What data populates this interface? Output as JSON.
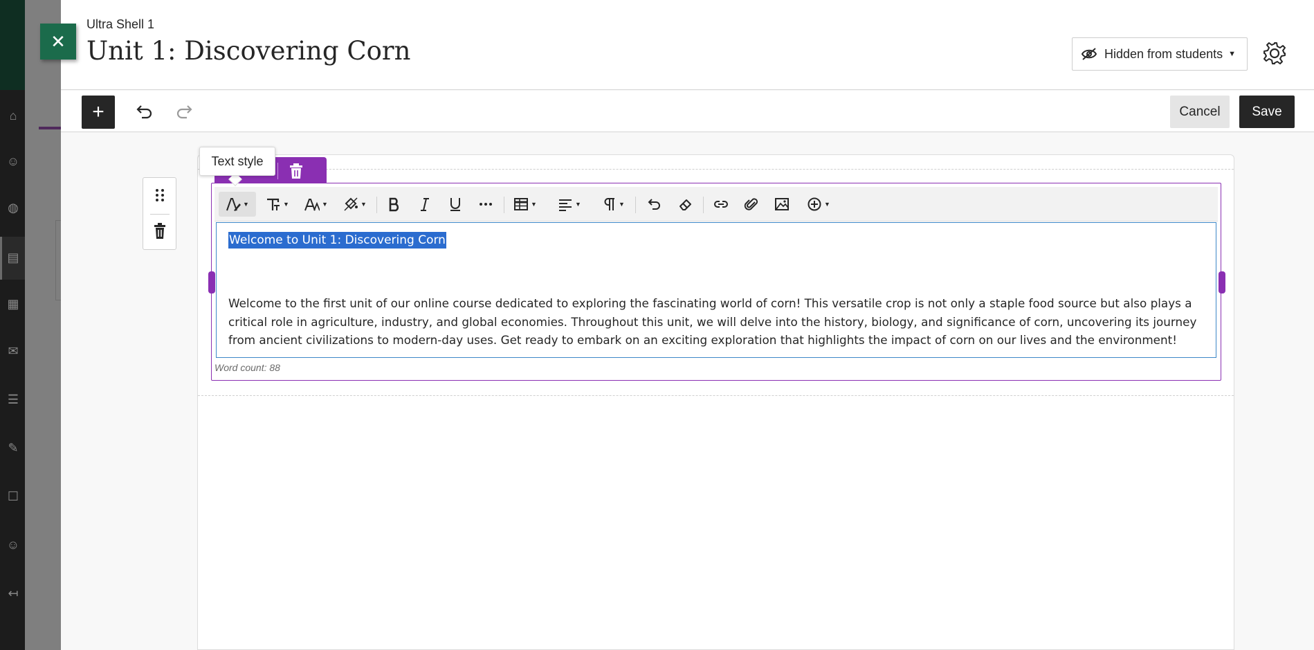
{
  "panel": {
    "course_name": "Ultra Shell 1",
    "title": "Unit 1: Discovering Corn",
    "close_glyph": "✕",
    "visibility": {
      "label": "Hidden from students",
      "icon": "eye-slash-icon"
    },
    "settings_icon": "gear-icon"
  },
  "toolbar": {
    "add_glyph": "+",
    "undo_icon": "undo-icon",
    "redo_icon": "redo-icon",
    "cancel_label": "Cancel",
    "save_label": "Save"
  },
  "tooltip": {
    "text": "Text style"
  },
  "rte": {
    "buttons": [
      {
        "name": "text-style",
        "icon": "text-style-icon",
        "dropdown": true,
        "active": true
      },
      {
        "name": "text-format",
        "icon": "text-format-icon",
        "dropdown": true
      },
      {
        "name": "font-size",
        "icon": "font-size-icon",
        "dropdown": true
      },
      {
        "name": "text-color",
        "icon": "paint-bucket-icon",
        "dropdown": true
      },
      {
        "name": "bold",
        "icon": "bold-icon"
      },
      {
        "name": "italic",
        "icon": "italic-icon"
      },
      {
        "name": "underline",
        "icon": "underline-icon"
      },
      {
        "name": "more",
        "icon": "more-dots-icon"
      },
      {
        "name": "table",
        "icon": "table-icon",
        "dropdown": true
      },
      {
        "name": "align",
        "icon": "align-left-icon",
        "dropdown": true
      },
      {
        "name": "paragraph",
        "icon": "pilcrow-icon",
        "dropdown": true
      },
      {
        "name": "undo",
        "icon": "undo-icon"
      },
      {
        "name": "clear-format",
        "icon": "eraser-icon"
      },
      {
        "name": "link",
        "icon": "link-icon"
      },
      {
        "name": "attach",
        "icon": "paperclip-icon"
      },
      {
        "name": "image",
        "icon": "image-icon"
      },
      {
        "name": "insert",
        "icon": "plus-circle-icon",
        "dropdown": true
      }
    ],
    "heading": "Welcome to Unit 1: Discovering Corn",
    "paragraph": "Welcome to the first unit of our online course dedicated to exploring the fascinating world of corn! This versatile crop is not only a staple food source but also plays a critical role in agriculture, industry, and global economies. Throughout this unit, we will delve into the history, biology, and significance of corn, uncovering its journey from ancient civilizations to modern-day uses. Get ready to embark on an exciting exploration that highlights the impact of corn on our lives and the environment!",
    "word_count": "Word count: 88"
  },
  "colors": {
    "accent_purple": "#8a2fb2",
    "close_green": "#1b6b4b",
    "selection_blue": "#2b6ccf",
    "focus_blue": "#3d88c8"
  }
}
